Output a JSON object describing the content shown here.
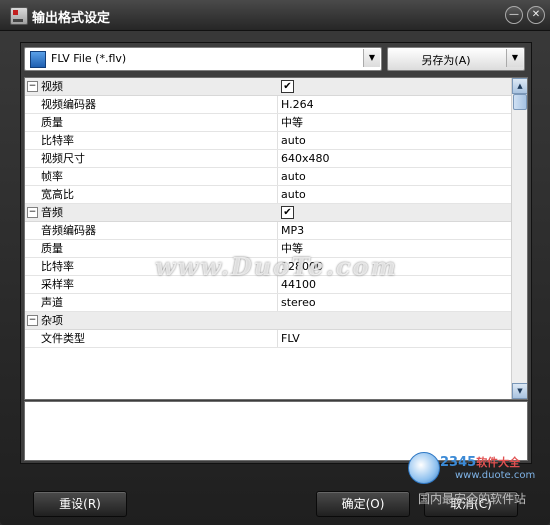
{
  "window": {
    "title": "输出格式设定",
    "minimize_label": "—",
    "close_label": "✕"
  },
  "toolbar": {
    "format_value": "FLV File (*.flv)",
    "save_as_label": "另存为(A)"
  },
  "properties": {
    "video": {
      "label": "视频",
      "enabled": true,
      "rows": [
        {
          "name": "视频编码器",
          "value": "H.264"
        },
        {
          "name": "质量",
          "value": "中等"
        },
        {
          "name": "比特率",
          "value": "auto"
        },
        {
          "name": "视频尺寸",
          "value": "640x480"
        },
        {
          "name": "帧率",
          "value": "auto"
        },
        {
          "name": "宽高比",
          "value": "auto"
        }
      ]
    },
    "audio": {
      "label": "音频",
      "enabled": true,
      "rows": [
        {
          "name": "音频编码器",
          "value": "MP3"
        },
        {
          "name": "质量",
          "value": "中等"
        },
        {
          "name": "比特率",
          "value": "128000"
        },
        {
          "name": "采样率",
          "value": "44100"
        },
        {
          "name": "声道",
          "value": "stereo"
        }
      ]
    },
    "misc": {
      "label": "杂项",
      "rows": [
        {
          "name": "文件类型",
          "value": "FLV"
        }
      ]
    }
  },
  "footer": {
    "reset_label": "重设(R)",
    "ok_label": "确定(O)",
    "cancel_label": "取消(C)"
  },
  "overlay": {
    "watermark": "www.DuoTe.com",
    "badge_brand": "2345",
    "badge_suffix": "软件大全",
    "badge_url": "www.duote.com",
    "slogan": "国内最安全的软件站"
  },
  "colors": {
    "window_bg": "#2b2b2b",
    "category_bg": "#ececec",
    "grid_bg": "#ffffff"
  }
}
